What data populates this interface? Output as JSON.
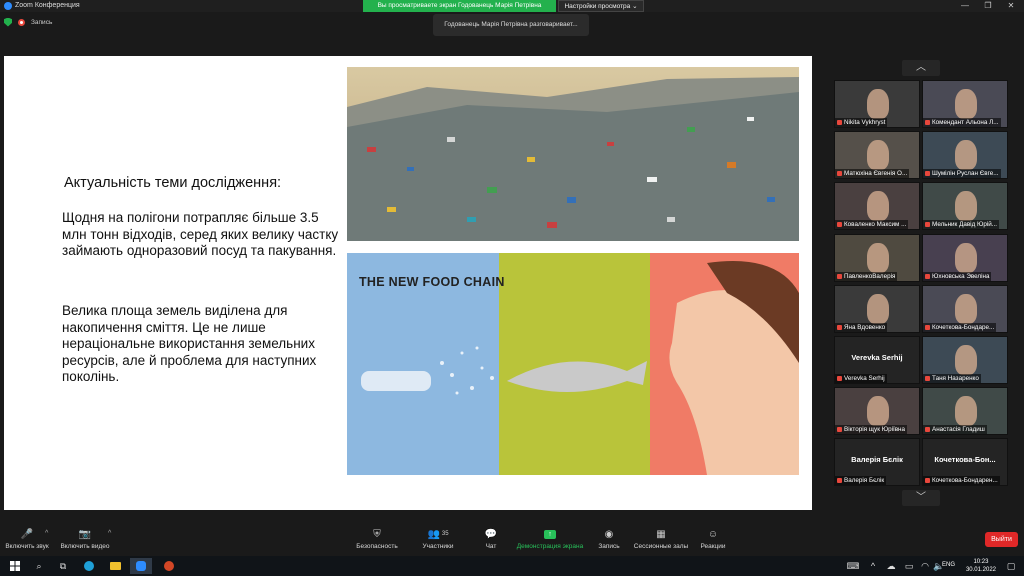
{
  "window": {
    "title": "Zoom Конференция",
    "share_banner": "Вы просматриваете экран Годованець Марія Петрівна",
    "view_options": "Настройки просмотра",
    "minimize": "—",
    "maximize": "❐",
    "close": "✕"
  },
  "recording": {
    "label": "Запись"
  },
  "speaking_banner": "Годованець Марія Петрівна разговаривает...",
  "slide": {
    "heading": "Актуальність теми дослідження:",
    "paragraph1": "Щодня на полігони потрапляє більше 3.5 млн тонн відходів, серед яких велику частку займають одноразовий посуд та пакування.",
    "paragraph2": "Велика площа земель виділена для накопичення сміття. Це не лише нераціональне використання земельних ресурсів, але й проблема для наступних поколінь.",
    "food_chain_title": "THE NEW FOOD CHAIN"
  },
  "gallery": {
    "up": "︿",
    "down": "﹀",
    "participants": [
      {
        "name": "Nikita Vykhryst",
        "big": ""
      },
      {
        "name": "Комендант Альона Л...",
        "big": ""
      },
      {
        "name": "Матюхіна Євгенія О...",
        "big": ""
      },
      {
        "name": "Шумілін Руслан Євге...",
        "big": ""
      },
      {
        "name": "Коваленко Максим ...",
        "big": ""
      },
      {
        "name": "Мельник Давід Юрій...",
        "big": ""
      },
      {
        "name": "ПавленкоВалерія",
        "big": ""
      },
      {
        "name": "Юхновська Эвеліна",
        "big": ""
      },
      {
        "name": "Яна Вдовенко",
        "big": ""
      },
      {
        "name": "Кочеткова-Бондаре...",
        "big": ""
      },
      {
        "name": "Verevka Serhij",
        "big": "Verevka Serhij"
      },
      {
        "name": "Таня Назаренко",
        "big": ""
      },
      {
        "name": "Вікторія щук Юріївна",
        "big": ""
      },
      {
        "name": "Анастасія Гладиш",
        "big": ""
      },
      {
        "name": "Валерія Бєлік",
        "big": "Валерія Бєлік"
      },
      {
        "name": "Кочеткова-Бондарен...",
        "big": "Кочеткова-Бон..."
      }
    ]
  },
  "toolbar": {
    "unmute": "Включить звук",
    "start_video": "Включить видео",
    "security": "Безопасность",
    "participants": "Участники",
    "participants_count": "35",
    "chat": "Чат",
    "share_screen": "Демонстрация экрана",
    "record": "Запись",
    "breakout": "Сессионные залы",
    "reactions": "Реакции",
    "leave": "Выйти"
  },
  "taskbar": {
    "language": "ENG",
    "time": "10:23",
    "date": "30.01.2022"
  },
  "colors": {
    "share_green": "#23b14d",
    "leave_red": "#e02828",
    "zoom_blue": "#2d8cff"
  }
}
